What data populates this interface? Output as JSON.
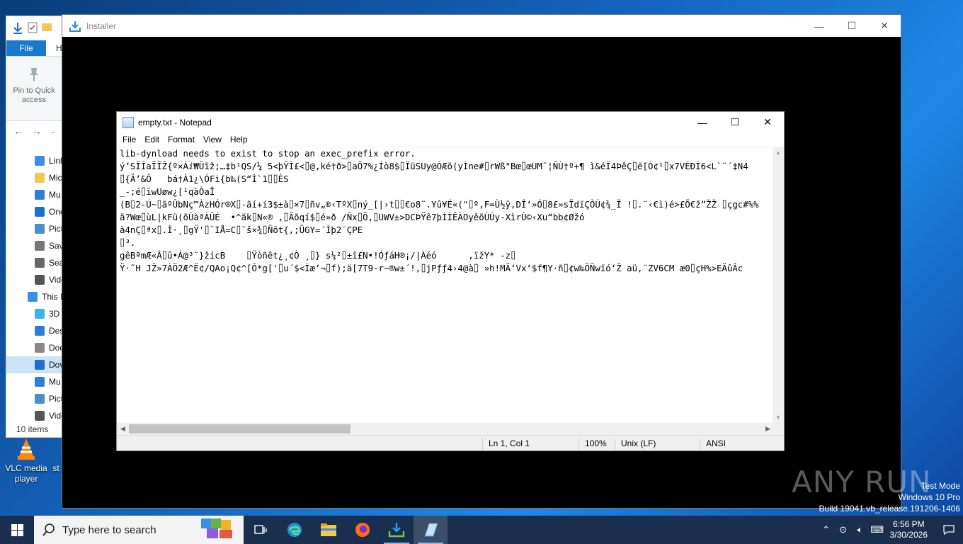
{
  "explorer": {
    "file_tab": "File",
    "home_tab": "H",
    "pin_label": "Pin to Quick access",
    "tree": [
      {
        "label": "Linl",
        "icon": "link-icon"
      },
      {
        "label": "Mic",
        "icon": "folder-icon"
      },
      {
        "label": "Mu",
        "icon": "music-icon"
      },
      {
        "label": "One",
        "icon": "onedrive-icon"
      },
      {
        "label": "Pict",
        "icon": "pictures-icon"
      },
      {
        "label": "Sav",
        "icon": "saved-games-icon"
      },
      {
        "label": "Sea",
        "icon": "search-icon"
      },
      {
        "label": "Vide",
        "icon": "videos-icon"
      },
      {
        "label": "This I",
        "icon": "pc-icon"
      },
      {
        "label": "3D",
        "icon": "3d-objects-icon"
      },
      {
        "label": "Des",
        "icon": "desktop-icon"
      },
      {
        "label": "Doc",
        "icon": "documents-icon"
      },
      {
        "label": "Dov",
        "icon": "downloads-icon"
      },
      {
        "label": "Mu",
        "icon": "music-icon"
      },
      {
        "label": "Pict",
        "icon": "pictures-icon"
      },
      {
        "label": "Vide",
        "icon": "videos-icon"
      }
    ],
    "status": "10 items"
  },
  "desktop": {
    "vlc_label": "VLC media player",
    "partial_label": "st"
  },
  "installer": {
    "title": "Installer"
  },
  "notepad": {
    "title": "empty.txt - Notepad",
    "menu": [
      "File",
      "Edit",
      "Format",
      "View",
      "Help"
    ],
    "lines": [
      "lib-dynload needs to exist to stop an exec_prefix error.",
      "ý’SÏÎaÏÏŽ{º×Àⅈ₩Üïž;…‡b¹QS/¼ 5<þŸÌ£<⌷@,ké†ð>⌷aÕ7%¿Íò8$⌷ÏüSUy@ÓÆö(yÌne#⌷rWß\"Bœ⌷œUM¯¦ÑÙ†º+¶ ì&éÏ4ÞêÇ⌷ë[Ò¢¹⌷x7VÉÐÍ6<L`¨´‡N4",
      "⌷{Ä’&Ô   bá†À1¿\\ÓFi{b‰(S“Ì`1⌷⌷ÈS",
      "_-;é⌷ïwUøw¿[¹qàÒaÎ",
      "(B⌷2-Ú~⌷ãºÛbNç™ÀzHÓr®X⌷-ãí+í3$±à⌷×7⌷ñv„®‹TºX⌷ný_[|›t⌷⌷€o8¨.Yû¥É«(\"⌷º,F=Ù½ÿ,DÎ‘»Ó⌷8£»sÏdïÇÒÚ¢¾_Ï !⌷.¨‹€ì)é>£Õ€ž”ŽŽ ⌷çgc#%%",
      "ä?Wœ⌷ùL|kFü(õÙàªÀÛÉ  •^äk⌷N«® ,⌷Ãõqí$⌷é»ð /Ñx⌷Õ,⌷UWV±>DCÞŸê7þÌÌÊÀOyêõÙÚy-XìrÙ©‹Xu“bb¢Øžó",
      "à4nÇ⌷ªx⌷.Ì·¸⌷gŸ'⌷¯IÅ=C⌷¯š×¾⌷Ñõt{,;ÜGY=´Ìþ2¨ÇPE",
      "⌷³.",
      "gêBªmÆ«Â⌷û•Á@³¨}žícB    ⌷Ÿòñêt¿¸¢Ò ¸⌷} s¼²⌷±î£N•!ÓƒáH®¡/|Àéó      ,ïžY* -z⌷",
      "Ÿ·˜H JŽ»7ÀÖ2Æ^Ë¢/QAo¡Q¢^[Ô*g['⌷u´$<Ìæ‘¬⌷f);ä[7T9-r~®w±´!,⌷jPƒƒ4›4@à⌷ »h!MÃ‘Vx‘$f¶Y·ñ⌷¢w‰ÖÑwïó‘Ž aü,¨ZV6CM æ0⌷çH%>EÄûÂc"
    ],
    "status": {
      "position": "Ln 1, Col 1",
      "zoom": "100%",
      "line_ending": "Unix (LF)",
      "encoding": "ANSI"
    }
  },
  "watermark": "ANY RUN",
  "test_mode": {
    "line1": "Test Mode",
    "line2": "Windows 10 Pro",
    "line3": "Build 19041.vb_release.191206-1406"
  },
  "taskbar": {
    "search_placeholder": "Type here to search",
    "time": "6:56 PM",
    "date": "3/30/2026"
  }
}
